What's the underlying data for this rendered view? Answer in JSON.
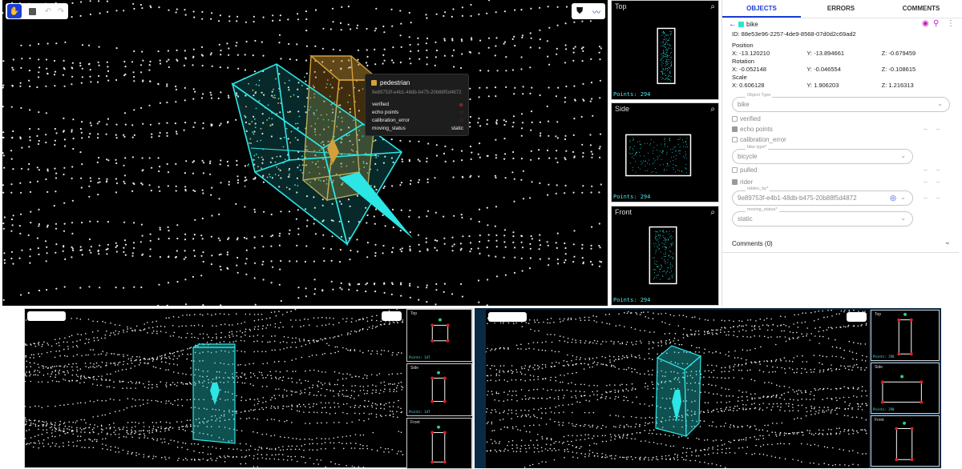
{
  "main_viewer": {
    "tools": {
      "pan": "hand-icon",
      "select": "box-select-icon",
      "undo": "undo-icon",
      "redo": "redo-icon"
    },
    "right_tools": {
      "shield": "shield-icon",
      "trend": "trend-icon"
    },
    "popup": {
      "label": "pedestrian",
      "id": "9e89753f-e4b1-48db-b475-20b88f5d4872",
      "rows": [
        {
          "key": "verified",
          "state": "error"
        },
        {
          "key": "echo points",
          "state": "warn"
        },
        {
          "key": "calibration_error",
          "state": "warn"
        },
        {
          "key": "moving_status",
          "value": "static"
        }
      ],
      "color": "#d4a03a"
    },
    "box_color": "#2ce6e6"
  },
  "side_views": [
    {
      "title": "Top",
      "points": "Points: 294"
    },
    {
      "title": "Side",
      "points": "Points: 294"
    },
    {
      "title": "Front",
      "points": "Points: 294"
    }
  ],
  "panel": {
    "tabs": [
      "OBJECTS",
      "ERRORS",
      "COMMENTS"
    ],
    "active_tab": "OBJECTS",
    "object_label": "bike",
    "object_color": "#2ce6c8",
    "id_text": "ID: 88e53e96-2257-4de9-8568-07d0d2c69ad2",
    "position": {
      "title": "Position",
      "x": "X: -13.120210",
      "y": "Y: -13.894661",
      "z": "Z: -0.679459"
    },
    "rotation": {
      "title": "Rotation",
      "x": "X: -0.052148",
      "y": "Y: -0.046554",
      "z": "Z: -0.108615"
    },
    "scale": {
      "title": "Scale",
      "x": "X: 0.606128",
      "y": "Y: 1.906203",
      "z": "Z: 1.216313"
    },
    "object_type": {
      "label": "Object Type",
      "value": "bike"
    },
    "verified": "verified",
    "echo_points": "echo points",
    "calibration_error": "calibration_error",
    "bike_type": {
      "label": "bike type*",
      "value": "bicycle"
    },
    "pulled": "pulled",
    "rider": "rider",
    "ridden_by": {
      "label": "ridden_by*",
      "value": "9e89753f-e4b1-48db-b475-20b88f5d4872"
    },
    "moving_status": {
      "label": "moving_status*",
      "value": "static"
    },
    "comments": "Comments (0)"
  },
  "bottom_left": {
    "side_views": [
      {
        "title": "Top",
        "points": "Points: 147"
      },
      {
        "title": "Side",
        "points": "Points: 147"
      },
      {
        "title": "Front",
        "points": ""
      }
    ]
  },
  "bottom_right": {
    "side_views": [
      {
        "title": "Top",
        "points": "Points: 298"
      },
      {
        "title": "Side",
        "points": "Points: 298"
      },
      {
        "title": "Front",
        "points": ""
      }
    ]
  }
}
